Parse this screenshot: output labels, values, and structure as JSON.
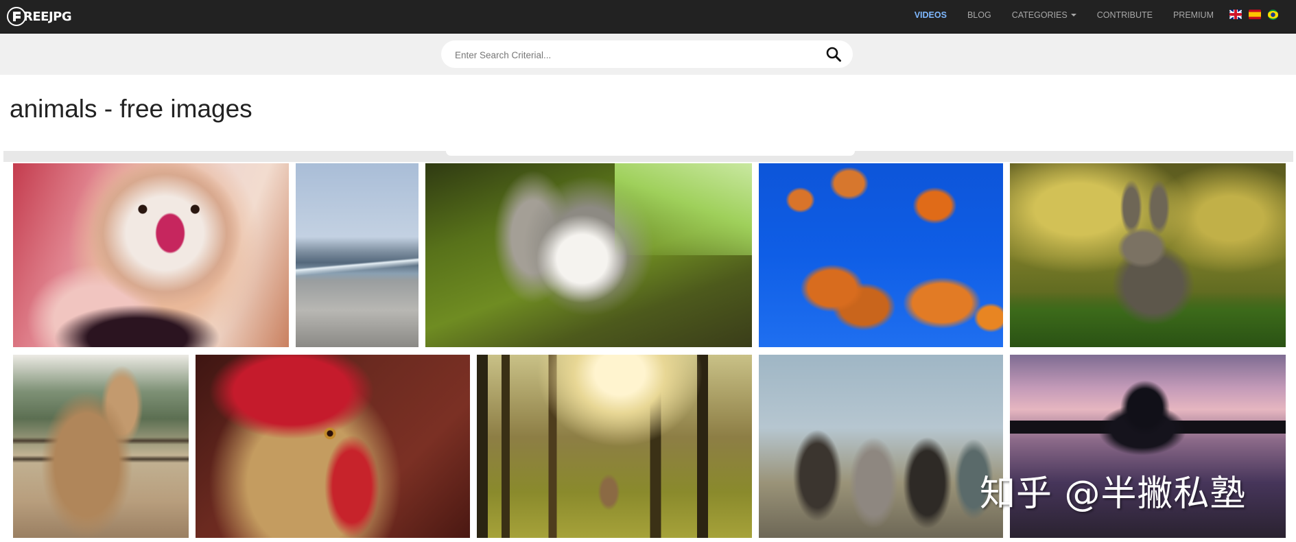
{
  "brand": {
    "logo_text": "REEJPG",
    "logo_initial": "F"
  },
  "nav": {
    "links": [
      {
        "label": "VIDEOS",
        "active": true
      },
      {
        "label": "BLOG",
        "active": false
      },
      {
        "label": "CATEGORIES",
        "active": false,
        "has_dropdown": true
      },
      {
        "label": "CONTRIBUTE",
        "active": false
      },
      {
        "label": "PREMIUM",
        "active": false
      }
    ],
    "flags": [
      "uk-flag-icon",
      "spain-flag-icon",
      "brazil-flag-icon"
    ]
  },
  "search": {
    "placeholder": "Enter Search Criterial...",
    "value": "",
    "icon": "search-icon"
  },
  "page": {
    "title": "animals - free images"
  },
  "gallery": {
    "rows": [
      [
        "yorkshire-terrier",
        "beach-shoreline",
        "squirrel",
        "jellyfish",
        "rabbit"
      ],
      [
        "horse",
        "rooster",
        "forest-sunlight",
        "gauchos-on-horses",
        "horse-rider-sunset"
      ]
    ]
  },
  "watermark": {
    "text": "知乎 @半撇私塾"
  },
  "colors": {
    "navbar_bg": "#222222",
    "nav_active": "#7fb8ff",
    "nav_text": "#a8a8a8",
    "search_band_bg": "#f0f0f0"
  }
}
